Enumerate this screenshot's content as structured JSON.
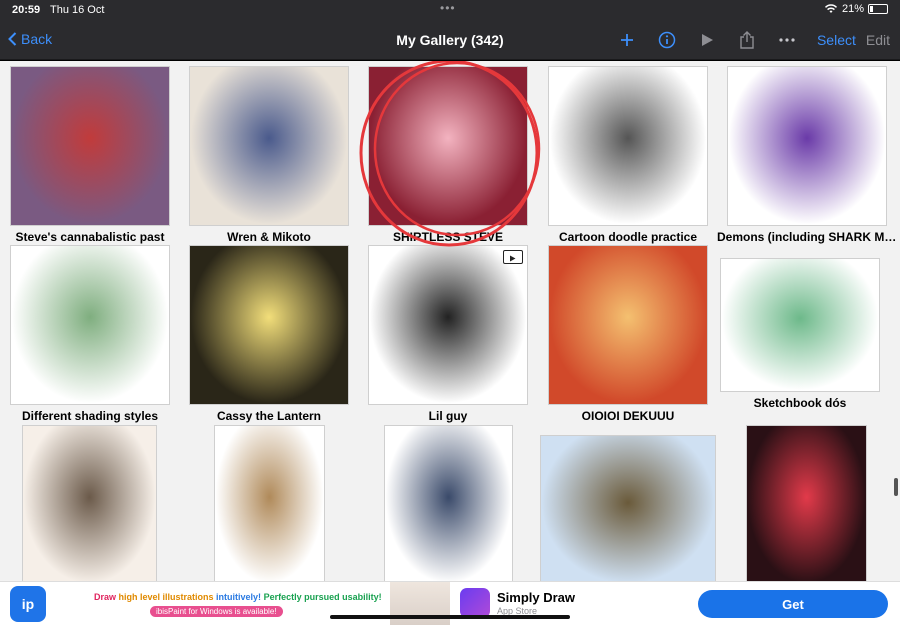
{
  "status": {
    "time": "20:59",
    "date": "Thu 16 Oct",
    "battery_percent": "21%",
    "battery_level": 0.21
  },
  "nav": {
    "back_label": "Back",
    "title": "My Gallery (342)",
    "select_label": "Select",
    "edit_label": "Edit",
    "icons": [
      "plus-icon",
      "info-icon",
      "play-icon",
      "share-icon",
      "more-icon"
    ]
  },
  "gallery": {
    "items": [
      {
        "caption": "Steve's cannabalistic past",
        "bg": "#7a5a82",
        "accent": "#c13b3b"
      },
      {
        "caption": "Wren & Mikoto",
        "bg": "#e9e2d8",
        "accent": "#4a5a8c"
      },
      {
        "caption": "SHIRTLESS STEVE",
        "bg": "#8a2033",
        "accent": "#f3b3c0"
      },
      {
        "caption": "Cartoon doodle practice",
        "bg": "#ffffff",
        "accent": "#555555"
      },
      {
        "caption": "Demons (including SHARK MA…",
        "bg": "#ffffff",
        "accent": "#6a3aa8"
      },
      {
        "caption": "Different shading styles",
        "bg": "#ffffff",
        "accent": "#7fae7f"
      },
      {
        "caption": "Cassy the Lantern",
        "bg": "#2a2618",
        "accent": "#f2de7a"
      },
      {
        "caption": "Lil guy",
        "bg": "#ffffff",
        "accent": "#222222"
      },
      {
        "caption": "OIOIOI DEKUUU",
        "bg": "#d1492a",
        "accent": "#f4c070"
      },
      {
        "caption": "Sketchbook dós",
        "bg": "#ffffff",
        "accent": "#6db98a"
      },
      {
        "caption": "",
        "bg": "#f6efe8",
        "accent": "#6b5a4a"
      },
      {
        "caption": "",
        "bg": "#ffffff",
        "accent": "#b08a5a"
      },
      {
        "caption": "",
        "bg": "#ffffff",
        "accent": "#3a4a6a"
      },
      {
        "caption": "",
        "bg": "#cfe0f2",
        "accent": "#6a5a3a"
      },
      {
        "caption": "",
        "bg": "#2a1015",
        "accent": "#e23a4a"
      }
    ]
  },
  "ad": {
    "line1_a": "Draw ",
    "line1_b": "high level illustrations ",
    "line1_c": "intuitively! ",
    "line1_d": "Perfectly pursued usability!",
    "line2": "ibisPaint for Windows is available!",
    "product_name": "Simply Draw",
    "product_sub": "App Store",
    "get_label": "Get"
  },
  "colors": {
    "accent": "#3d8ffb",
    "nav_bg": "#2b2b2e",
    "gallery_bg": "#f2f2f2",
    "get_button": "#1a73e8"
  }
}
